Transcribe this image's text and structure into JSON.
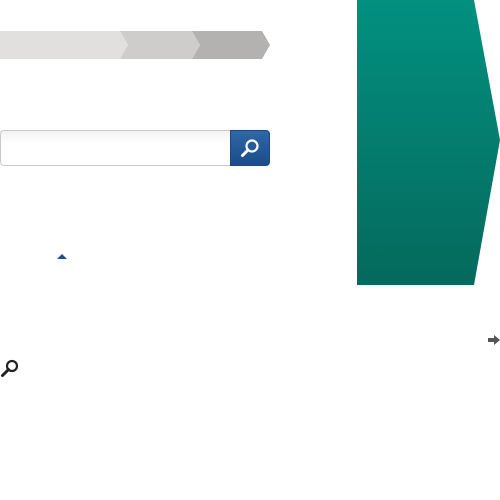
{
  "breadcrumb": {
    "steps": [
      {
        "label": "",
        "color": "#e2e0df"
      },
      {
        "label": "",
        "color": "#cecdcc"
      },
      {
        "label": "",
        "color": "#b3b2b1"
      }
    ]
  },
  "search": {
    "value": "",
    "placeholder": "",
    "button_icon": "search-icon",
    "button_color": "#1f4f8c"
  },
  "caret": {
    "icon": "caret-up-icon",
    "color": "#1d4f8c"
  },
  "banner": {
    "shape": "right-pointing-arrow",
    "color_top": "#02907f",
    "color_bottom": "#05695d"
  },
  "icons": {
    "right_arrow": "arrow-right-icon",
    "magnifier": "magnifier-icon"
  }
}
